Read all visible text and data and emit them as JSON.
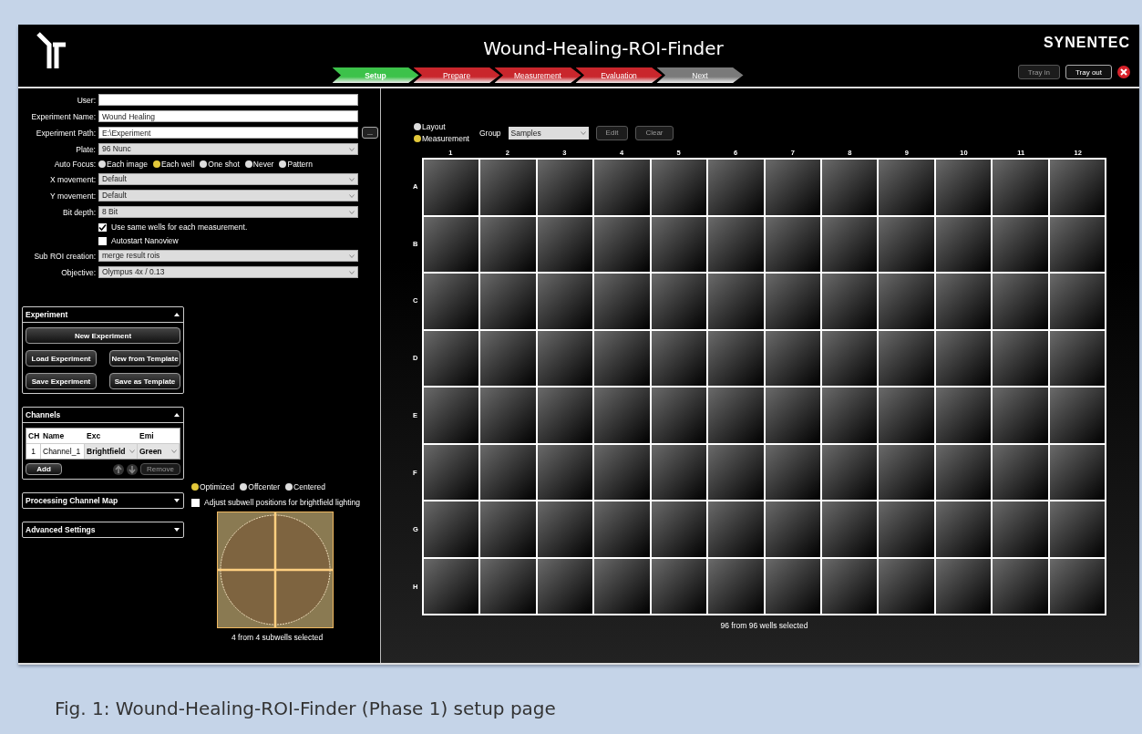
{
  "window": {
    "title": "Wound-Healing-ROI-Finder",
    "brand": "SYNENTEC"
  },
  "steps": [
    {
      "label": "Setup",
      "color": "#3cc24a",
      "selected": true
    },
    {
      "label": "Prepare",
      "color": "#c9262c",
      "selected": false
    },
    {
      "label": "Measurement",
      "color": "#c9262c",
      "selected": false
    },
    {
      "label": "Evaluation",
      "color": "#c9262c",
      "selected": false
    },
    {
      "label": "Next",
      "color": "#7a7a7a",
      "selected": false
    }
  ],
  "tray_buttons": [
    {
      "label": "Tray in",
      "disabled": true
    },
    {
      "label": "Tray out",
      "disabled": false
    }
  ],
  "form": [
    {
      "kind": "text",
      "label": "User:"
    },
    {
      "kind": "text",
      "label": "Experiment Name:",
      "value": "Wound Healing"
    },
    {
      "kind": "path",
      "label": "Experiment Path:",
      "value": "E:\\Experiment",
      "button": "..."
    },
    {
      "kind": "select",
      "label": "Plate:",
      "value": "96 Nunc"
    },
    {
      "kind": "radio",
      "label": "Auto Focus:",
      "options": [
        {
          "label": "Each image",
          "selected": false
        },
        {
          "label": "Each well",
          "selected": true
        },
        {
          "label": "One shot",
          "selected": false
        },
        {
          "label": "Never",
          "selected": false
        },
        {
          "label": "Pattern",
          "selected": false
        }
      ]
    },
    {
      "kind": "select",
      "label": "X movement:",
      "value": "Default"
    },
    {
      "kind": "select",
      "label": "Y movement:",
      "value": "Default"
    },
    {
      "kind": "select",
      "label": "Bit depth:",
      "value": "8 Bit"
    },
    {
      "kind": "checkbox",
      "label": "Use same wells for each measurement.",
      "checked": true
    },
    {
      "kind": "checkbox",
      "label": "Autostart Nanoview",
      "checked": false
    },
    {
      "kind": "select",
      "label": "Sub ROI creation:",
      "value": "merge result rois"
    },
    {
      "kind": "select",
      "label": "Objective:",
      "value": "Olympus 4x / 0.13"
    }
  ],
  "experiment_panel": {
    "title": "Experiment",
    "expanded": true,
    "buttons": [
      "New Experiment",
      "Load Experiment",
      "New from Template",
      "Save Experiment",
      "Save as Template"
    ]
  },
  "channels_panel": {
    "title": "Channels",
    "expanded": true,
    "columns": [
      "CH",
      "Name",
      "Exc",
      "Emi"
    ],
    "rows": [
      {
        "ch": "1",
        "name": "Channel_1",
        "exc": "Brightfield",
        "emi": "Green"
      }
    ],
    "add": "Add",
    "remove": {
      "label": "Remove",
      "disabled": true
    }
  },
  "collapsed_panels": [
    {
      "title": "Processing Channel Map",
      "expanded": false
    },
    {
      "title": "Advanced Settings",
      "expanded": false
    }
  ],
  "subwells": {
    "positions": [
      {
        "label": "Optimized",
        "selected": true
      },
      {
        "label": "Offcenter",
        "selected": false
      },
      {
        "label": "Centered",
        "selected": false
      }
    ],
    "adjust": {
      "label": "Adjust subwell positions for brightfield lighting",
      "checked": false
    },
    "status": "4 from 4 subwells selected"
  },
  "plate": {
    "modes": [
      {
        "label": "Layout",
        "selected": false
      },
      {
        "label": "Measurement",
        "selected": true
      }
    ],
    "group_label": "Group",
    "group_value": "Samples",
    "buttons": [
      {
        "label": "Edit",
        "disabled": true
      },
      {
        "label": "Clear",
        "disabled": true
      }
    ],
    "columns": [
      "1",
      "2",
      "3",
      "4",
      "5",
      "6",
      "7",
      "8",
      "9",
      "10",
      "11",
      "12"
    ],
    "rows": [
      "A",
      "B",
      "C",
      "D",
      "E",
      "F",
      "G",
      "H"
    ],
    "status": "96 from 96 wells selected"
  },
  "caption": "Fig. 1: Wound-Healing-ROI-Finder (Phase 1) setup page"
}
